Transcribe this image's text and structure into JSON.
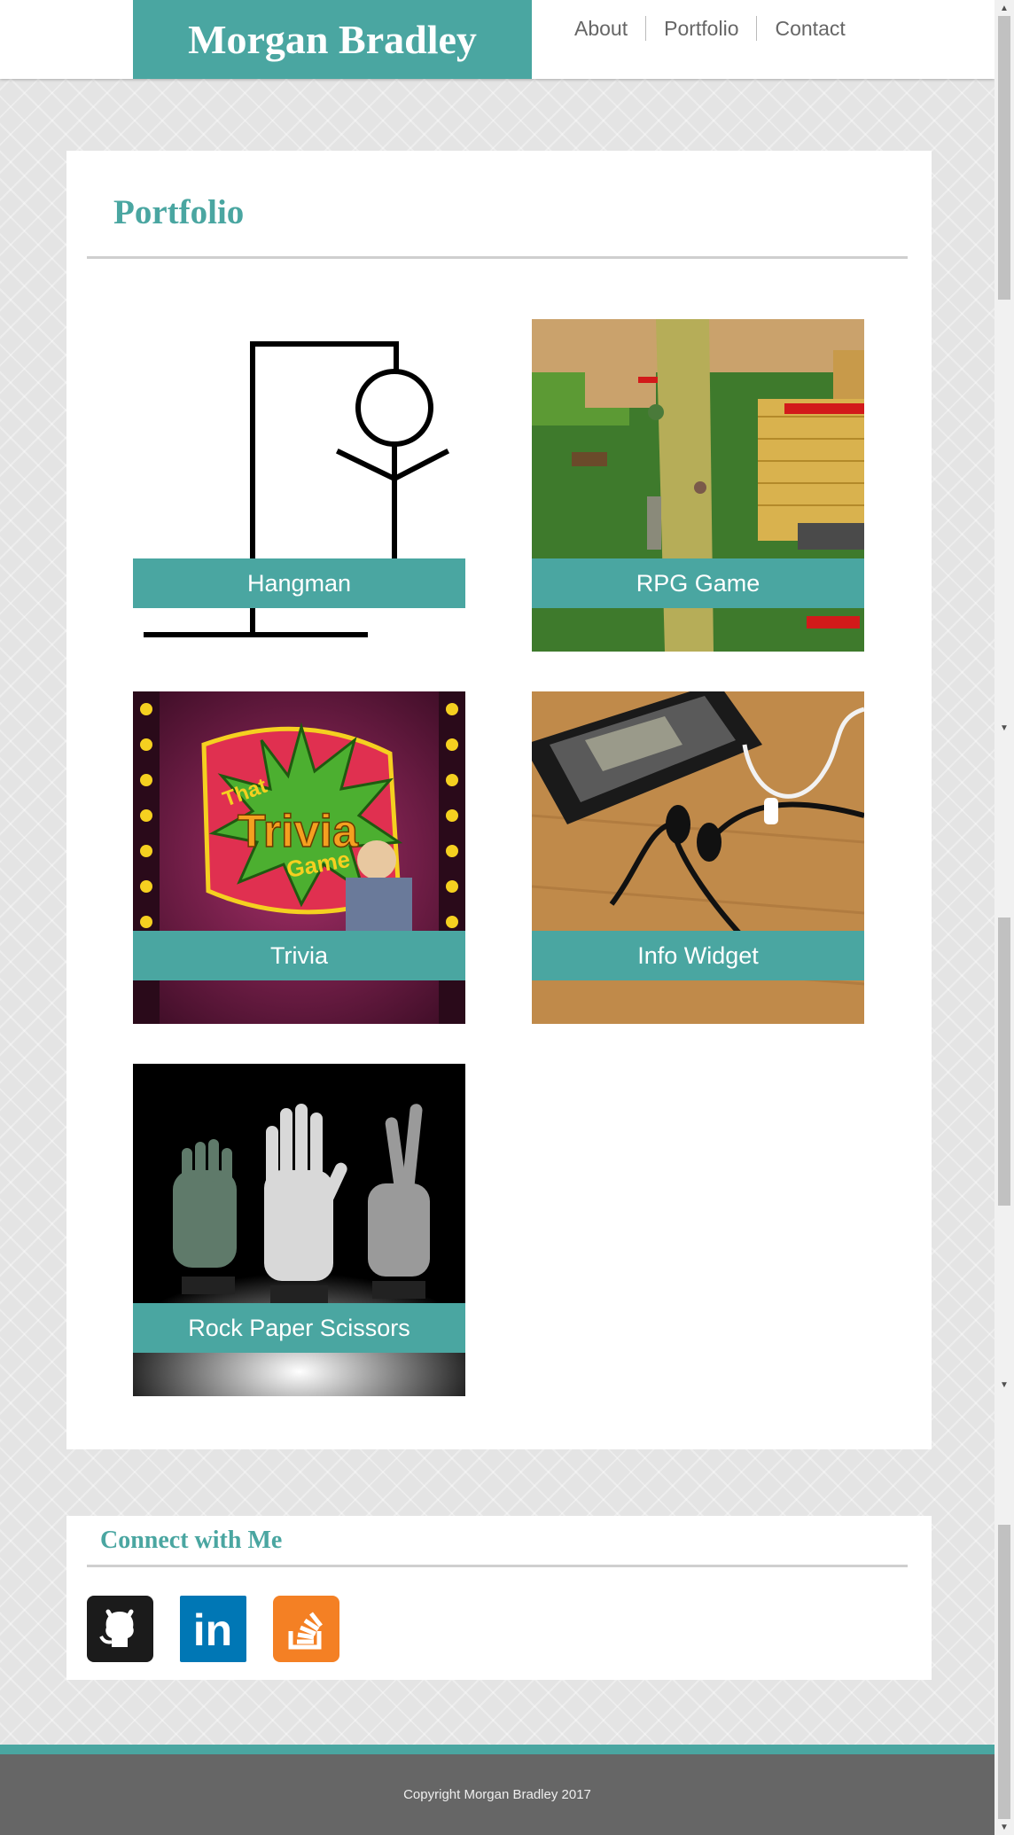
{
  "header": {
    "brand": "Morgan Bradley",
    "nav": [
      "About",
      "Portfolio",
      "Contact"
    ]
  },
  "portfolio": {
    "title": "Portfolio",
    "items": [
      {
        "label": "Hangman"
      },
      {
        "label": "RPG Game"
      },
      {
        "label": "Trivia"
      },
      {
        "label": "Info Widget"
      },
      {
        "label": "Rock Paper Scissors"
      }
    ]
  },
  "trivia_logo": {
    "line1": "That",
    "line2": "Trivia",
    "line3": "Game"
  },
  "connect": {
    "title": "Connect with Me",
    "links": [
      {
        "icon": "github-icon"
      },
      {
        "icon": "linkedin-icon",
        "text": "in"
      },
      {
        "icon": "stackoverflow-icon"
      }
    ]
  },
  "footer": {
    "copyright": "Copyright Morgan Bradley 2017"
  },
  "colors": {
    "accent": "#4aa6a1",
    "footer": "#666666",
    "github": "#1b1b1b",
    "linkedin": "#0077b5",
    "stackoverflow": "#f48024"
  }
}
